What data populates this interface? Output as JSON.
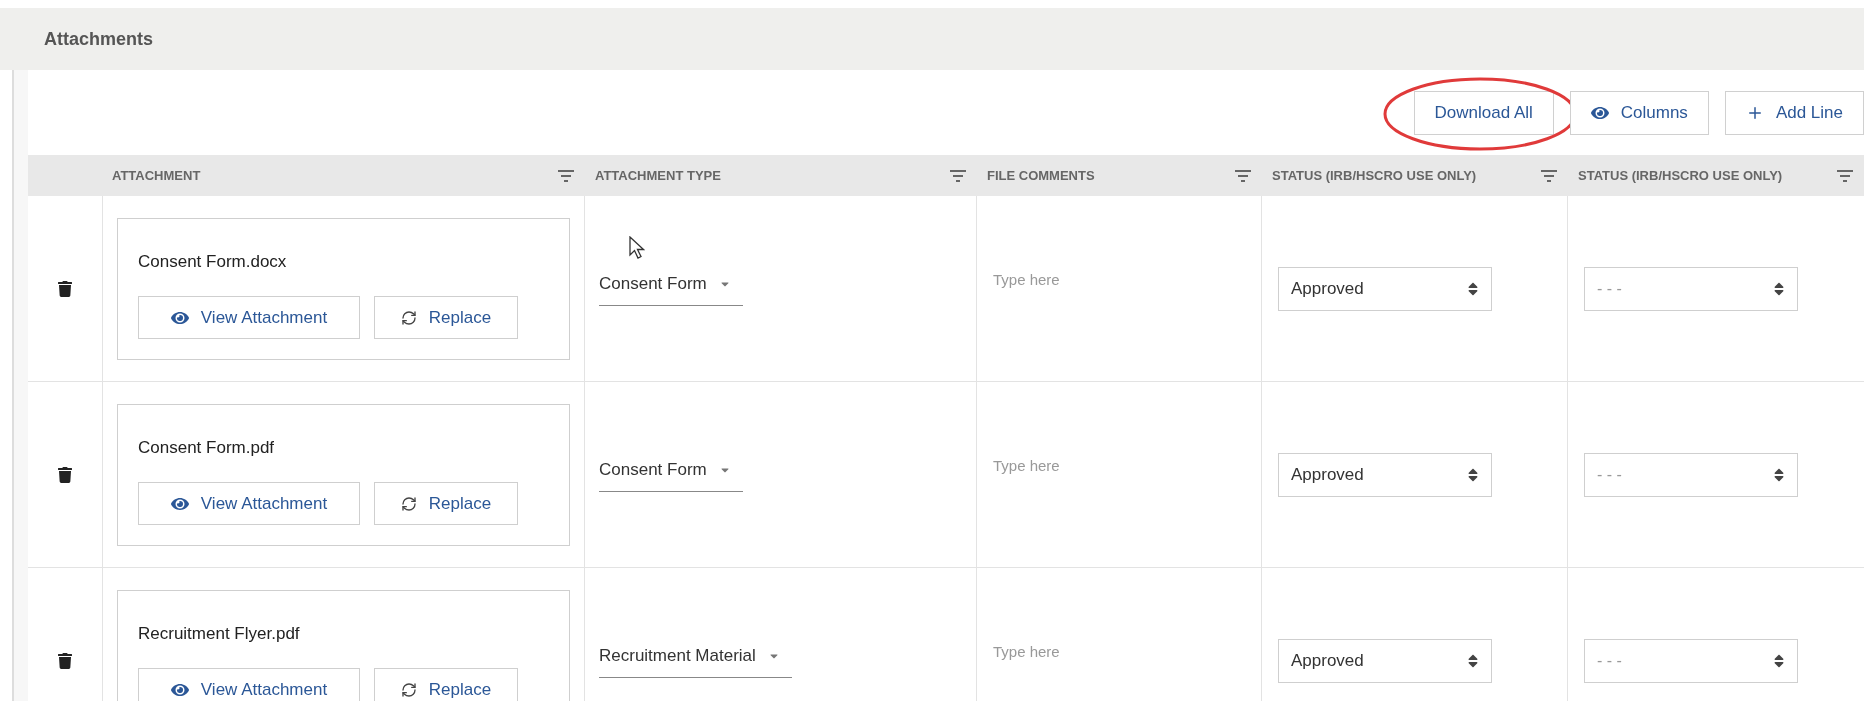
{
  "panel": {
    "title": "Attachments"
  },
  "toolbar": [
    {
      "kind": "plain",
      "label": "Download All",
      "circled": true
    },
    {
      "kind": "eye",
      "label": "Columns",
      "circled": false
    },
    {
      "kind": "plus",
      "label": "Add Line",
      "circled": false
    }
  ],
  "table": {
    "columns": [
      "ATTACHMENT",
      "ATTACHMENT TYPE",
      "FILE COMMENTS",
      "STATUS (IRB/HSCRO USE ONLY)",
      "STATUS (IRB/HSCRO USE ONLY)"
    ],
    "rows": [
      {
        "file": "Consent Form.docx",
        "view_label": "View Attachment",
        "replace_label": "Replace",
        "type": "Consent Form",
        "comments_placeholder": "Type here",
        "status_1": "Approved",
        "status_2": "- - -",
        "cursor": true
      },
      {
        "file": "Consent Form.pdf",
        "view_label": "View Attachment",
        "replace_label": "Replace",
        "type": "Consent Form",
        "comments_placeholder": "Type here",
        "status_1": "Approved",
        "status_2": "- - -",
        "cursor": false
      },
      {
        "file": "Recruitment Flyer.pdf",
        "view_label": "View Attachment",
        "replace_label": "Replace",
        "type": "Recruitment Material",
        "comments_placeholder": "Type here",
        "status_1": "Approved",
        "status_2": "- - -",
        "cursor": false
      }
    ]
  }
}
